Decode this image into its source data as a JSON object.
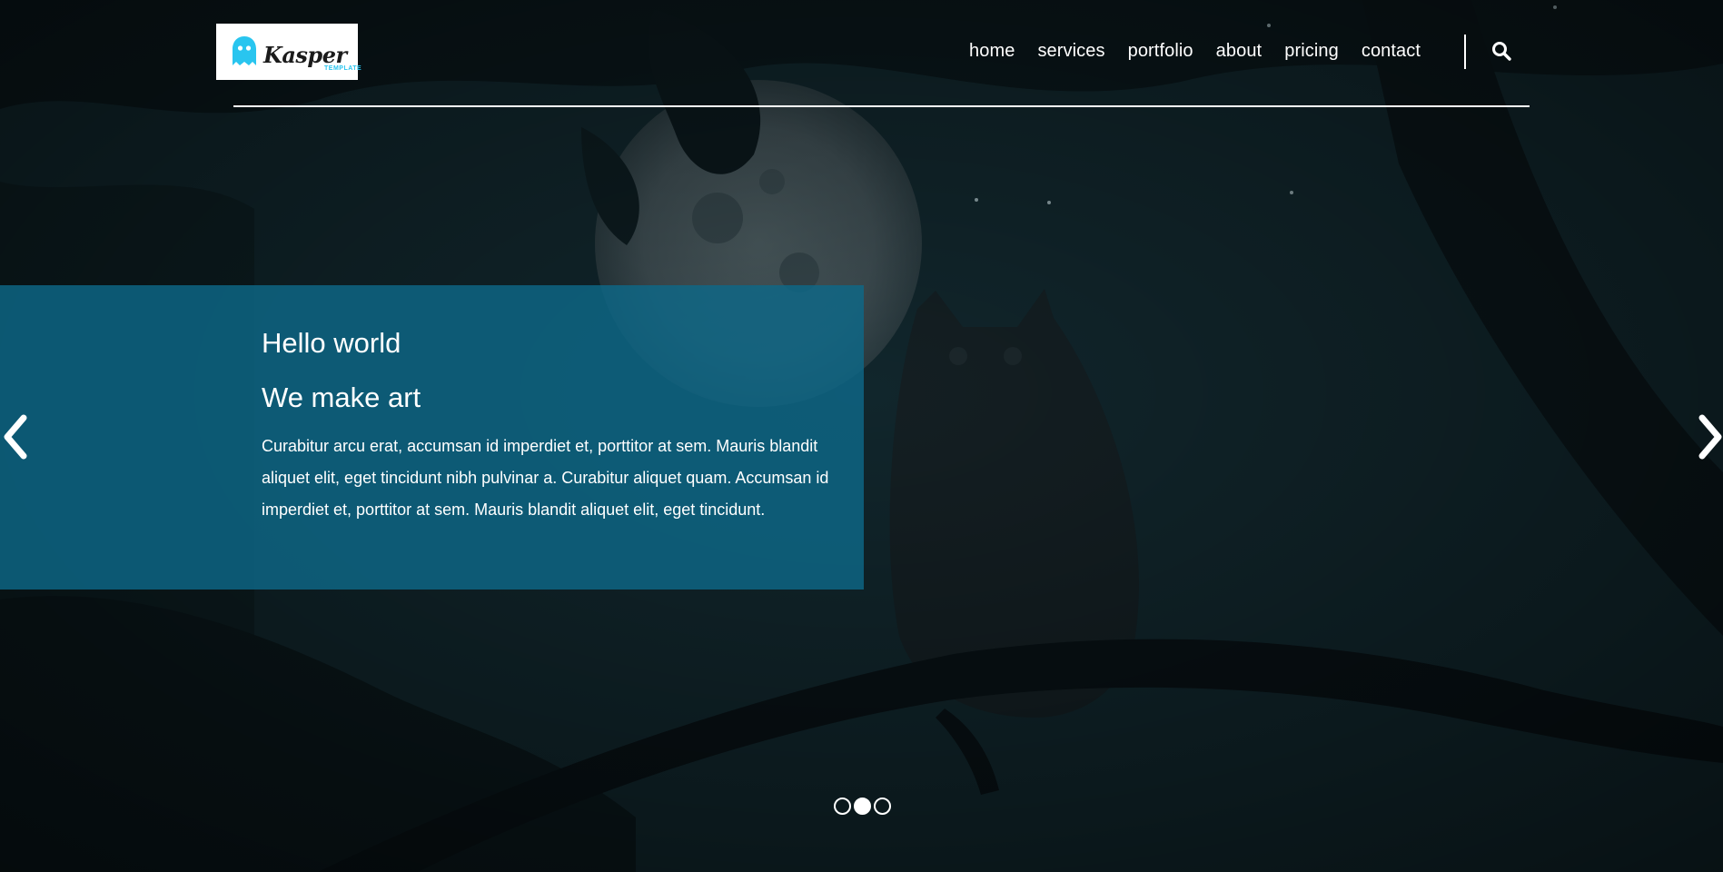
{
  "brand": {
    "name": "Kasper",
    "tagline": "TEMPLATE",
    "accent_color": "#29c5ef",
    "icon": "ghost-logo-icon"
  },
  "nav": {
    "items": [
      {
        "label": "home"
      },
      {
        "label": "services"
      },
      {
        "label": "portfolio"
      },
      {
        "label": "about"
      },
      {
        "label": "pricing"
      },
      {
        "label": "contact"
      }
    ],
    "search_icon": "search-icon"
  },
  "slider": {
    "caption": {
      "title": "Hello world",
      "subtitle": "We make art",
      "body": "Curabitur arcu erat, accumsan id imperdiet et, porttitor at sem. Mauris blandit aliquet elit, eget tincidunt nibh pulvinar a. Curabitur aliquet quam. Accumsan id imperdiet et, porttitor at sem. Mauris blandit aliquet elit, eget tincidunt.",
      "background_color": "#0e6887"
    },
    "prev_icon": "chevron-left-icon",
    "next_icon": "chevron-right-icon",
    "indicators": {
      "count": 3,
      "active_index": 1
    }
  }
}
